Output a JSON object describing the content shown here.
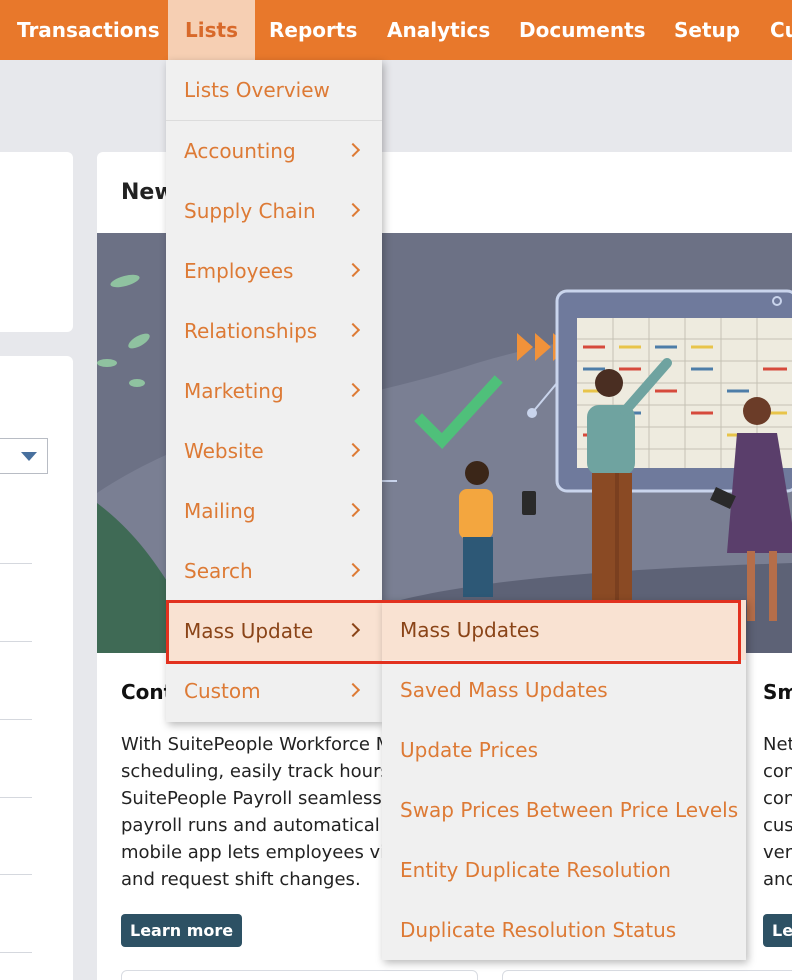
{
  "nav": {
    "items": [
      {
        "label": "Transactions",
        "active": false
      },
      {
        "label": "Lists",
        "active": true
      },
      {
        "label": "Reports",
        "active": false
      },
      {
        "label": "Analytics",
        "active": false
      },
      {
        "label": "Documents",
        "active": false
      },
      {
        "label": "Setup",
        "active": false
      },
      {
        "label": "Cu",
        "active": false
      }
    ]
  },
  "lists_menu": {
    "overview": "Lists Overview",
    "items": [
      {
        "label": "Accounting"
      },
      {
        "label": "Supply Chain"
      },
      {
        "label": "Employees"
      },
      {
        "label": "Relationships"
      },
      {
        "label": "Marketing"
      },
      {
        "label": "Website"
      },
      {
        "label": "Mailing"
      },
      {
        "label": "Search"
      },
      {
        "label": "Mass Update",
        "highlighted": true
      },
      {
        "label": "Custom"
      }
    ]
  },
  "mass_update_submenu": {
    "items": [
      {
        "label": "Mass Updates",
        "highlighted": true
      },
      {
        "label": "Saved Mass Updates"
      },
      {
        "label": "Update Prices"
      },
      {
        "label": "Swap Prices Between Price Levels"
      },
      {
        "label": "Entity Duplicate Resolution"
      },
      {
        "label": "Duplicate Resolution Status"
      }
    ]
  },
  "news_card": {
    "title": "New",
    "heading": "Cont",
    "description_lines": [
      "With SuitePeople Workforce M",
      "scheduling, easily track hours",
      "SuitePeople Payroll seamless",
      "payroll runs and automatical",
      "mobile app lets employees vi",
      "and request shift changes."
    ],
    "learn_more": "Learn more"
  },
  "side_card": {
    "heading": "Sm",
    "description_lines": [
      "Net",
      "con",
      "con",
      "cus",
      "ver",
      "and"
    ],
    "learn_more": "Le"
  },
  "colors": {
    "nav_bg": "#e8782b",
    "nav_active_bg": "#f6cfb3",
    "menu_text": "#dd7a35",
    "menu_highlight_bg": "#f9e2d2",
    "highlight_border": "#e2311f",
    "button_bg": "#2d5164"
  }
}
